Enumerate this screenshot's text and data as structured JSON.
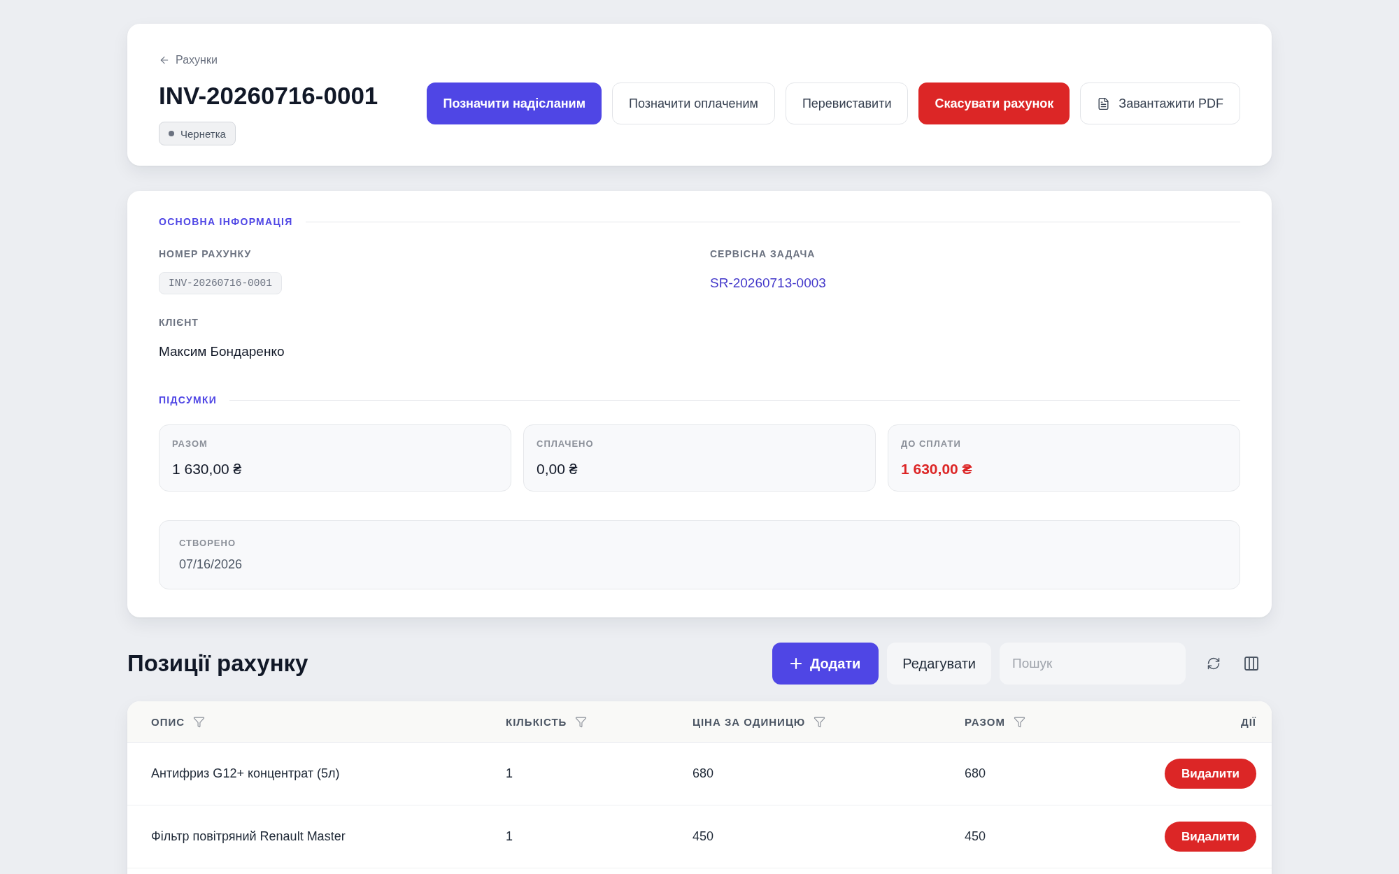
{
  "breadcrumb": {
    "label": "Рахунки"
  },
  "header": {
    "title": "INV-20260716-0001",
    "status": {
      "label": "Чернетка"
    },
    "actions": [
      {
        "label": "Позначити надісланим",
        "kind": "primary"
      },
      {
        "label": "Позначити оплаченим",
        "kind": "secondary"
      },
      {
        "label": "Перевиставити",
        "kind": "secondary"
      },
      {
        "label": "Скасувати рахунок",
        "kind": "danger"
      },
      {
        "label": "Завантажити PDF",
        "kind": "file"
      }
    ]
  },
  "main_info": {
    "title": "ОСНОВНА ІНФОРМАЦІЯ",
    "fields": [
      {
        "label": "НОМЕР РАХУНКУ",
        "value": "INV-20260716-0001",
        "kind": "code"
      },
      {
        "label": "СЕРВІСНА ЗАДАЧА",
        "value": "SR-20260713-0003",
        "kind": "link"
      },
      {
        "label": "КЛІЄНТ",
        "value": "Максим Бондаренко",
        "kind": "text"
      }
    ]
  },
  "totals": {
    "title": "ПІДСУМКИ",
    "cards": [
      {
        "label": "РАЗОМ",
        "value": "1 630,00 ₴",
        "kind": "plain"
      },
      {
        "label": "СПЛАЧЕНО",
        "value": "0,00 ₴",
        "kind": "plain"
      },
      {
        "label": "ДО СПЛАТИ",
        "value": "1 630,00 ₴",
        "kind": "due"
      }
    ]
  },
  "created": {
    "label": "СТВОРЕНО",
    "value": "07/16/2026"
  },
  "items": {
    "title": "Позиції рахунку",
    "add_button": "Додати",
    "edit_button": "Редагувати",
    "search": {
      "placeholder": "Пошук"
    },
    "table": {
      "columns": [
        {
          "label": "ОПИС",
          "filter": true
        },
        {
          "label": "КІЛЬКІСТЬ",
          "filter": true
        },
        {
          "label": "ЦІНА ЗА ОДИНИЦЮ",
          "filter": true
        },
        {
          "label": "РАЗОМ",
          "filter": true
        },
        {
          "label": "ДІЇ",
          "filter": false
        }
      ],
      "rows": [
        {
          "cells": [
            "Антифриз G12+ концентрат (5л)",
            "1",
            "680",
            "680"
          ],
          "action": "Видалити"
        },
        {
          "cells": [
            "Фільтр повітряний Renault Master",
            "1",
            "450",
            "450"
          ],
          "action": "Видалити"
        }
      ]
    }
  }
}
